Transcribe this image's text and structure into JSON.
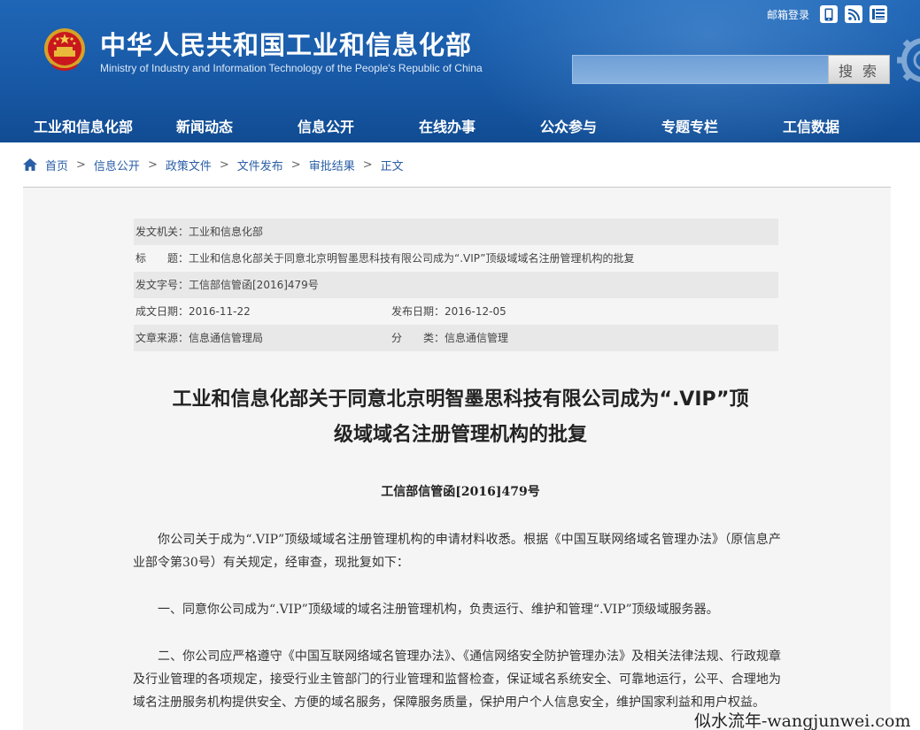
{
  "header": {
    "title": "中华人民共和国工业和信息化部",
    "subtitle": "Ministry of Industry and Information Technology of the People's Republic of China",
    "mail_login": "邮箱登录",
    "search_placeholder": "",
    "search_button": "搜 索",
    "icons": [
      "mobile-icon",
      "rss-icon",
      "sitemap-icon"
    ]
  },
  "nav": {
    "items": [
      "工业和信息化部",
      "新闻动态",
      "信息公开",
      "在线办事",
      "公众参与",
      "专题专栏",
      "工信数据"
    ]
  },
  "breadcrumb": {
    "items": [
      "首页",
      "信息公开",
      "政策文件",
      "文件发布",
      "审批结果",
      "正文"
    ]
  },
  "meta": {
    "issuer": "发文机关：工业和信息化部",
    "subject": "标　　题：工业和信息化部关于同意北京明智墨思科技有限公司成为“.VIP”顶级域域名注册管理机构的批复",
    "doc_no": "发文字号：工信部信管函[2016]479号",
    "written_date": "成文日期：2016-11-22",
    "publish_date": "发布日期：2016-12-05",
    "source": "文章来源：信息通信管理局",
    "category": "分　　类：信息通信管理"
  },
  "article": {
    "title_line1": "工业和信息化部关于同意北京明智墨思科技有限公司成为“.VIP”顶",
    "title_line2": "级域域名注册管理机构的批复",
    "number": "工信部信管函[2016]479号",
    "paragraphs": [
      "你公司关于成为“.VIP”顶级域域名注册管理机构的申请材料收悉。根据《中国互联网络域名管理办法》（原信息产业部令第30号）有关规定，经审查，现批复如下：",
      "一、同意你公司成为“.VIP”顶级域的域名注册管理机构，负责运行、维护和管理“.VIP”顶级域服务器。",
      "二、你公司应严格遵守《中国互联网络域名管理办法》、《通信网络安全防护管理办法》及相关法律法规、行政规章及行业管理的各项规定，接受行业主管部门的行业管理和监督检查，保证域名系统安全、可靠地运行，公平、合理地为域名注册服务机构提供安全、方便的域名服务，保障服务质量，保护用户个人信息安全，维护国家利益和用户权益。"
    ]
  },
  "watermark": "似水流年-wangjunwei.com",
  "colors": {
    "header_blue": "#1859a6",
    "link_blue": "#2a5ea6",
    "panel_bg": "#f5f5f5",
    "meta_shade": "#e8e8e8"
  }
}
